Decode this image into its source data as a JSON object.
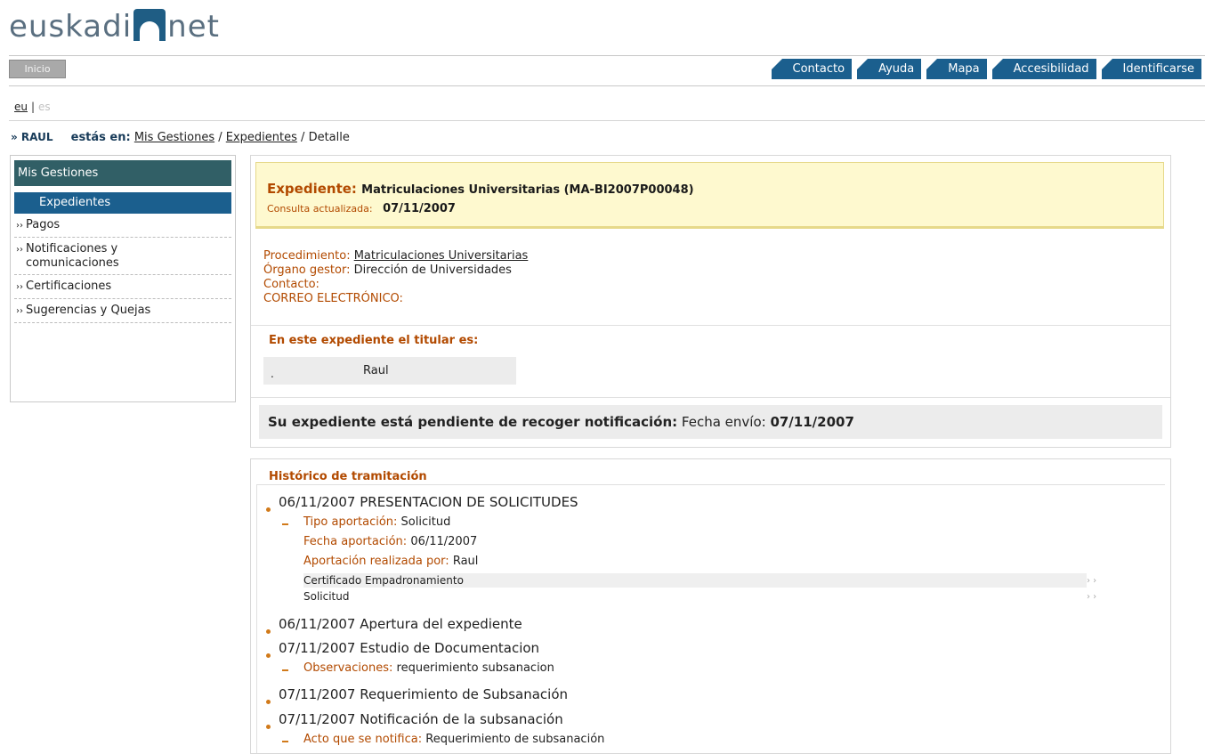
{
  "brand": {
    "left": "euskadi",
    "right": "net"
  },
  "inicio": "Inicio",
  "topnav": [
    "Contacto",
    "Ayuda",
    "Mapa",
    "Accesibilidad",
    "Identificarse"
  ],
  "lang": {
    "eu": "eu",
    "sep": "|",
    "es": "es"
  },
  "breadcrumb": {
    "user": "» RAUL",
    "label": "estás en:",
    "mis_gestiones": "Mis Gestiones",
    "sep1": " / ",
    "expedientes": "Expedientes",
    "sep2": " / ",
    "detalle": "Detalle"
  },
  "sidebar": {
    "title": "Mis Gestiones",
    "active": "Expedientes",
    "items": [
      {
        "bullet": "››",
        "line1": "Pagos"
      },
      {
        "bullet": "››",
        "line1": "Notificaciones y",
        "line2": "comunicaciones"
      },
      {
        "bullet": "››",
        "line1": "Certificaciones"
      },
      {
        "bullet": "››",
        "line1": "Sugerencias y Quejas"
      }
    ]
  },
  "expediente": {
    "label": "Expediente:",
    "value": "Matriculaciones Universitarias (MA-BI2007P00048)",
    "consulta_label": "Consulta actualizada:",
    "consulta_value": "07/11/2007"
  },
  "procedimiento": {
    "proc_label": "Procedimiento:",
    "proc_value": "Matriculaciones Universitarias",
    "organo_label": "Órgano gestor:",
    "organo_value": "Dirección de Universidades",
    "contacto_label": "Contacto:",
    "correo_label": "CORREO ELECTRÓNICO:"
  },
  "titular": {
    "title": "En este expediente el titular es:",
    "cell1": ".",
    "cell2": "Raul"
  },
  "pendiente": {
    "bold": "Su expediente está pendiente de recoger notificación:",
    "label": " Fecha envío: ",
    "date": "07/11/2007"
  },
  "historico": {
    "title": "Histórico de tramitación",
    "ev1": "06/11/2007 PRESENTACION DE SOLICITUDES",
    "ev1_tipo_label": "Tipo aportación:",
    "ev1_tipo": "Solicitud",
    "ev1_fecha_label": "Fecha aportación:",
    "ev1_fecha": "06/11/2007",
    "ev1_por_label": "Aportación realizada por:",
    "ev1_por": "Raul",
    "doc1": "Certificado Empadronamiento",
    "doc2": "Solicitud",
    "ev2": "06/11/2007 Apertura del expediente",
    "ev3": "07/11/2007 Estudio de Documentacion",
    "ev3_obs_label": "Observaciones:",
    "ev3_obs": "requerimiento subsanacion",
    "ev4": "07/11/2007 Requerimiento de Subsanación",
    "ev5": "07/11/2007 Notificación de la subsanación",
    "ev5_acto_label": "Acto que se notifica:",
    "ev5_acto": "Requerimiento de subsanación"
  },
  "colors": {
    "nav_blue": "#1b5f8e",
    "sidebar_head": "#315f66",
    "accent": "#b24a00",
    "highlight": "#fef9cf"
  }
}
